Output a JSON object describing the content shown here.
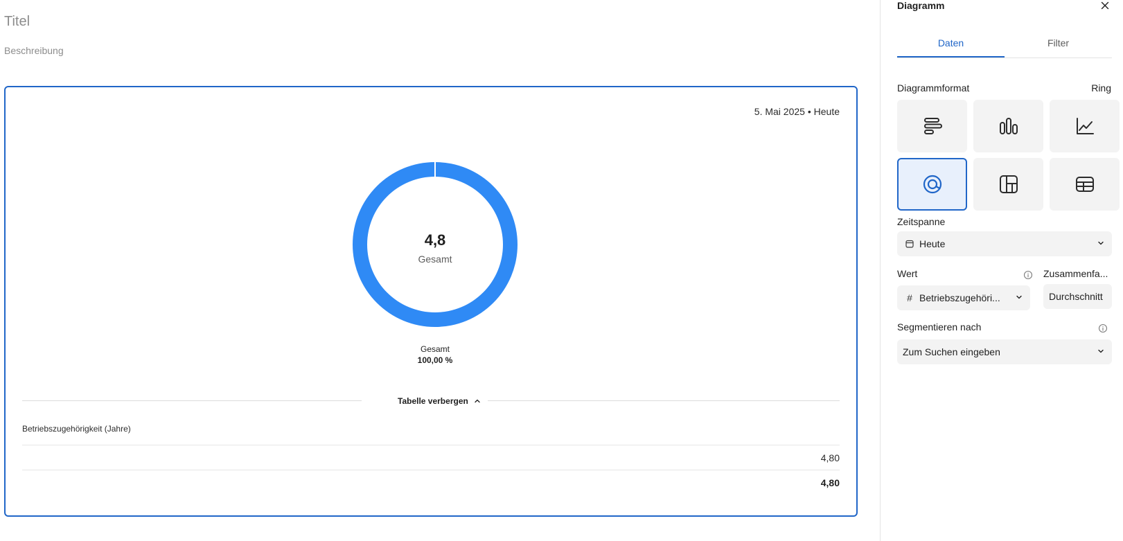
{
  "editor": {
    "title": "Titel",
    "description": "Beschreibung"
  },
  "card": {
    "date_range": "5. Mai 2025 • Heute",
    "total_value": "4,8",
    "total_label": "Gesamt",
    "legend_label": "Gesamt",
    "legend_percent": "100,00 %",
    "table_toggle_label": "Tabelle verbergen",
    "table": {
      "column_header": "Betriebszugehörigkeit (Jahre)",
      "rows": [
        "4,80"
      ],
      "total": "4,80"
    }
  },
  "chart_data": {
    "type": "pie",
    "categories": [
      "Gesamt"
    ],
    "values": [
      4.8
    ],
    "percentages": [
      100.0
    ],
    "donut": true,
    "center_value": "4,8",
    "center_label": "Gesamt",
    "color": "#2f8af5"
  },
  "panel": {
    "title": "Diagramm",
    "tabs": [
      {
        "label": "Daten",
        "active": true
      },
      {
        "label": "Filter",
        "active": false
      }
    ],
    "format_label": "Diagrammformat",
    "format_value": "Ring",
    "formats": [
      {
        "icon": "horizontal-bar-chart-icon"
      },
      {
        "icon": "vertical-bar-chart-icon"
      },
      {
        "icon": "line-chart-icon"
      },
      {
        "icon": "donut-chart-icon",
        "selected": true
      },
      {
        "icon": "treemap-chart-icon"
      },
      {
        "icon": "table-icon"
      }
    ],
    "timespan_label": "Zeitspanne",
    "timespan_value": "Heute",
    "value_label": "Wert",
    "summary_label": "Zusammenfa...",
    "value_field": "Betriebszugehöri...",
    "summary_value": "Durchschnitt",
    "segment_label": "Segmentieren nach",
    "segment_placeholder": "Zum Suchen eingeben",
    "accent_color": "#2066c8"
  }
}
